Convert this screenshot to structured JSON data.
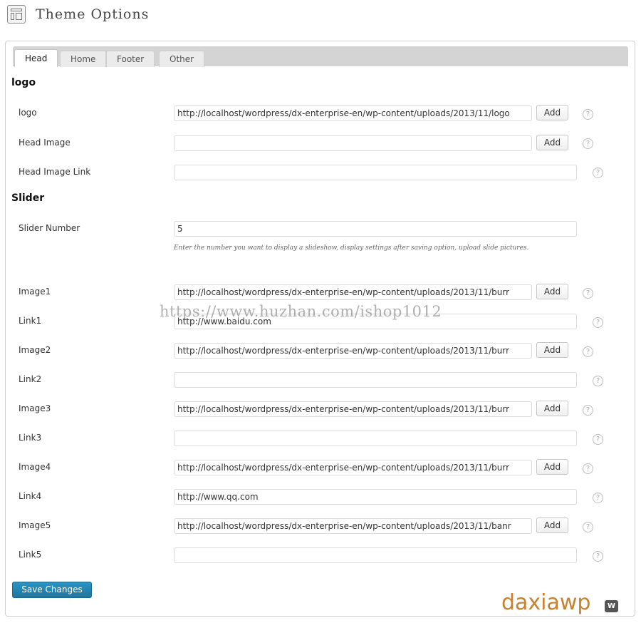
{
  "header": {
    "title": "Theme Options",
    "icon": "layout-icon"
  },
  "tabs": [
    {
      "label": "Head",
      "active": true
    },
    {
      "label": "Home",
      "active": false
    },
    {
      "label": "Footer",
      "active": false
    },
    {
      "label": "Other",
      "active": false
    }
  ],
  "sections": {
    "logo": "logo",
    "slider": "Slider"
  },
  "fields": {
    "logo": {
      "label": "logo",
      "value": "http://localhost/wordpress/dx-enterprise-en/wp-content/uploads/2013/11/logo",
      "button": "Add",
      "help": "?"
    },
    "head_image": {
      "label": "Head Image",
      "value": "",
      "button": "Add",
      "help": "?"
    },
    "head_image_link": {
      "label": "Head Image Link",
      "value": "",
      "help": "?"
    },
    "slider_number": {
      "label": "Slider Number",
      "value": "5",
      "description": "Enter the number you want to display a slideshow, display settings after saving option, upload slide pictures."
    },
    "image1": {
      "label": "Image1",
      "value": "http://localhost/wordpress/dx-enterprise-en/wp-content/uploads/2013/11/burr",
      "button": "Add",
      "help": "?"
    },
    "link1": {
      "label": "Link1",
      "value": "http://www.baidu.com",
      "help": "?"
    },
    "image2": {
      "label": "Image2",
      "value": "http://localhost/wordpress/dx-enterprise-en/wp-content/uploads/2013/11/burr",
      "button": "Add",
      "help": "?"
    },
    "link2": {
      "label": "Link2",
      "value": "",
      "help": "?"
    },
    "image3": {
      "label": "Image3",
      "value": "http://localhost/wordpress/dx-enterprise-en/wp-content/uploads/2013/11/burr",
      "button": "Add",
      "help": "?"
    },
    "link3": {
      "label": "Link3",
      "value": "",
      "help": "?"
    },
    "image4": {
      "label": "Image4",
      "value": "http://localhost/wordpress/dx-enterprise-en/wp-content/uploads/2013/11/burr",
      "button": "Add",
      "help": "?"
    },
    "link4": {
      "label": "Link4",
      "value": "http://www.qq.com",
      "help": "?"
    },
    "image5": {
      "label": "Image5",
      "value": "http://localhost/wordpress/dx-enterprise-en/wp-content/uploads/2013/11/banr",
      "button": "Add",
      "help": "?"
    },
    "link5": {
      "label": "Link5",
      "value": "",
      "help": "?"
    }
  },
  "watermark": "https://www.huzhan.com/ishop1012",
  "save_button": "Save Changes",
  "brand": {
    "name": "daxiawp",
    "logo_glyph": "W"
  },
  "colors": {
    "primary_button": "#21759b",
    "brand": "#c8812f"
  }
}
